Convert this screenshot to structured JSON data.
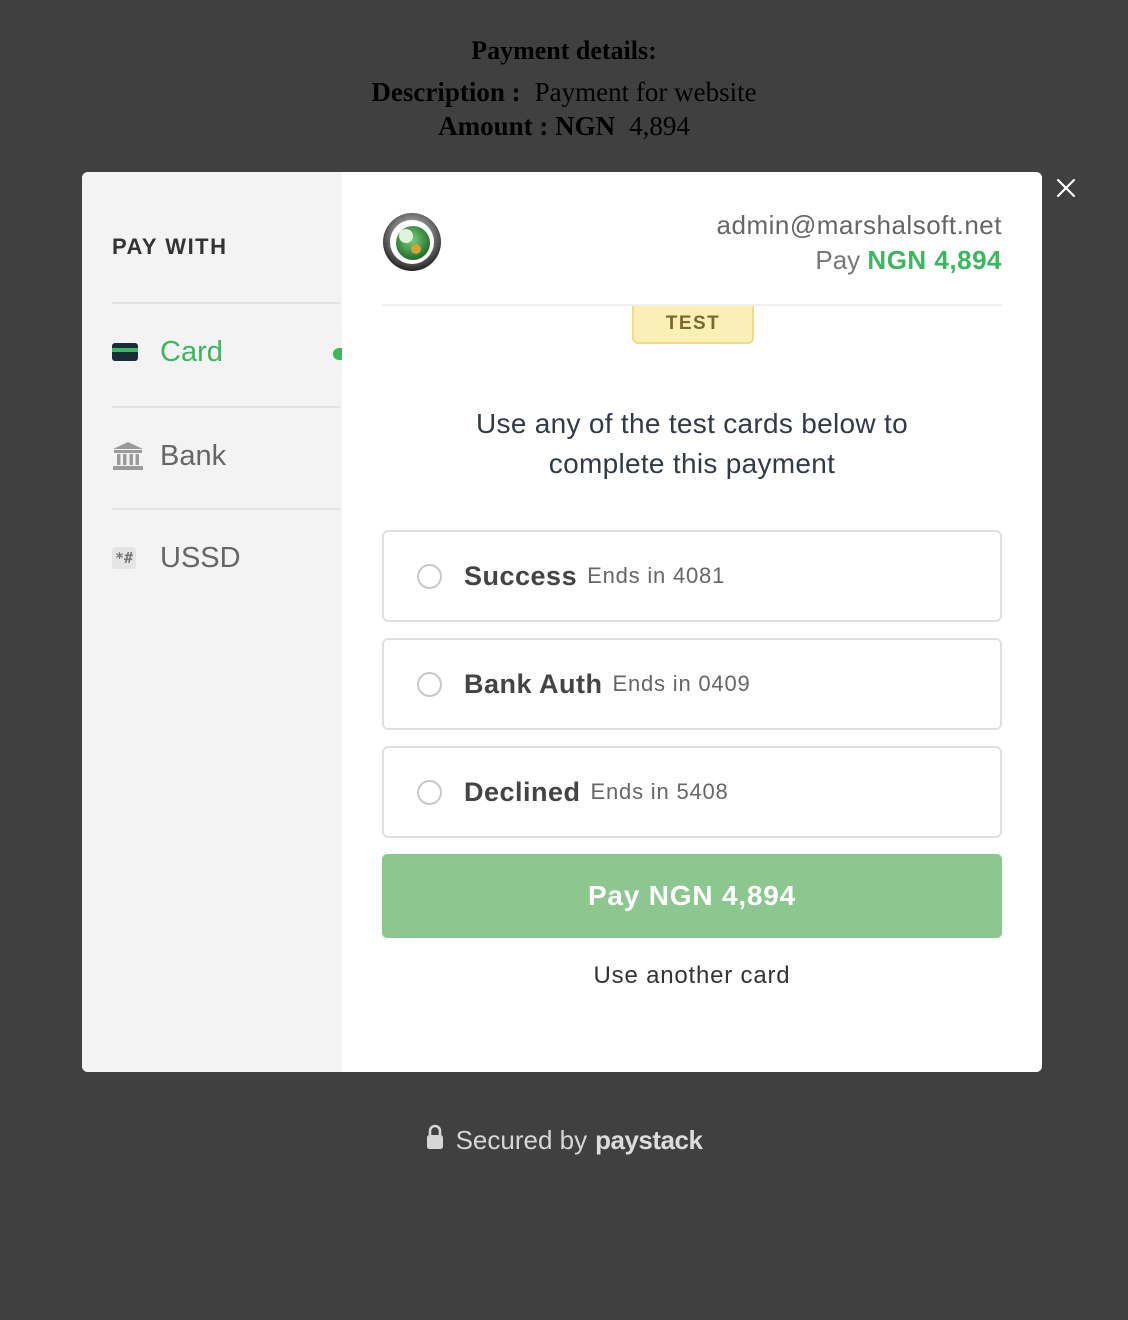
{
  "background": {
    "title": "Payment details:",
    "description_label": "Description :",
    "description_value": "Payment for website",
    "amount_label": "Amount : NGN",
    "amount_value": "4,894"
  },
  "sidebar": {
    "heading": "PAY WITH",
    "items": [
      {
        "label": "Card",
        "icon": "credit-card-icon",
        "active": true
      },
      {
        "label": "Bank",
        "icon": "bank-icon",
        "active": false
      },
      {
        "label": "USSD",
        "icon": "ussd-icon",
        "icon_text": "*#",
        "active": false
      }
    ]
  },
  "header": {
    "email": "admin@marshalsoft.net",
    "pay_prefix": "Pay",
    "amount": "NGN 4,894"
  },
  "badge": "TEST",
  "instructions": {
    "line1": "Use any of the test cards below to",
    "line2": "complete this payment"
  },
  "cards": [
    {
      "name": "Success",
      "ends": "Ends in 4081"
    },
    {
      "name": "Bank Auth",
      "ends": "Ends in 0409"
    },
    {
      "name": "Declined",
      "ends": "Ends in 5408"
    }
  ],
  "pay_button": "Pay NGN 4,894",
  "another_card": "Use another card",
  "footer": {
    "secured_text": "Secured by",
    "brand": "paystack"
  },
  "colors": {
    "overlay": "#404040",
    "accent": "#3bb75e",
    "button": "#8bc78f",
    "badge_bg": "#fbefb8"
  }
}
